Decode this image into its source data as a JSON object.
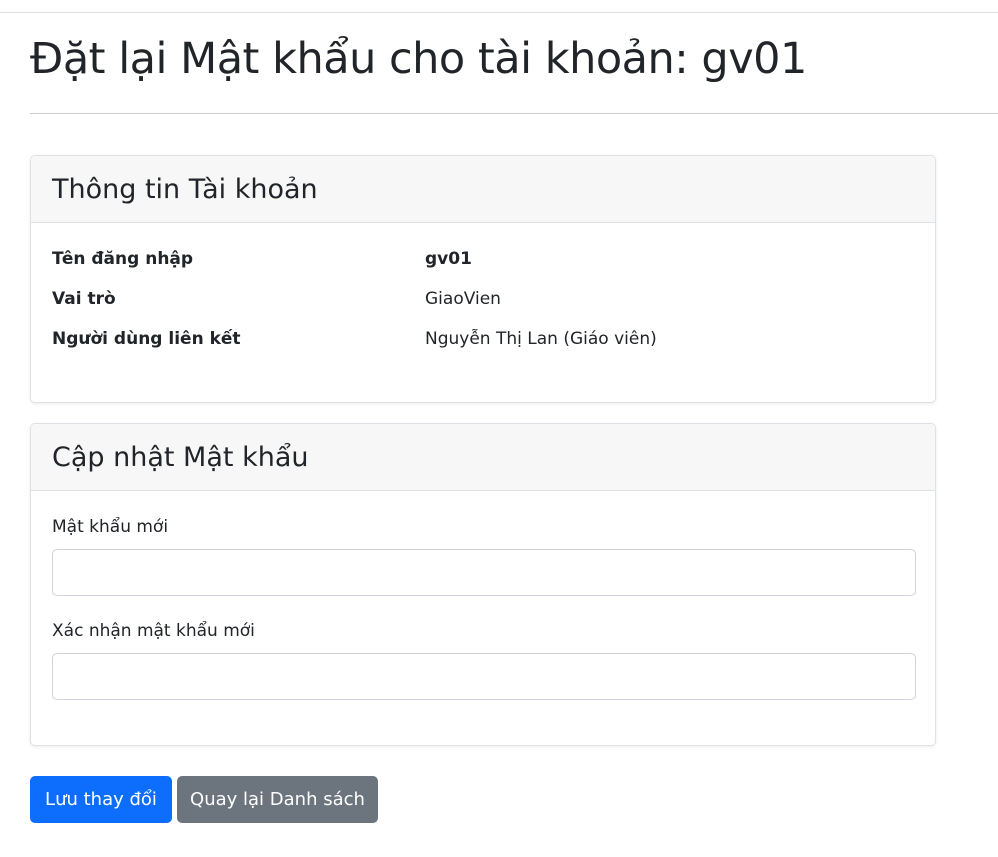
{
  "page": {
    "title": "Đặt lại Mật khẩu cho tài khoản: gv01"
  },
  "account_card": {
    "title": "Thông tin Tài khoản",
    "rows": [
      {
        "label": "Tên đăng nhập",
        "value": "gv01"
      },
      {
        "label": "Vai trò",
        "value": "GiaoVien"
      },
      {
        "label": "Người dùng liên kết",
        "value": "Nguyễn Thị Lan (Giáo viên)"
      }
    ]
  },
  "password_card": {
    "title": "Cập nhật Mật khẩu",
    "new_password_label": "Mật khẩu mới",
    "new_password_value": "",
    "confirm_label": "Xác nhận mật khẩu mới",
    "confirm_value": ""
  },
  "actions": {
    "save_label": "Lưu thay đổi",
    "back_label": "Quay lại Danh sách"
  },
  "colors": {
    "primary": "#0d6efd",
    "secondary": "#6c757d"
  }
}
